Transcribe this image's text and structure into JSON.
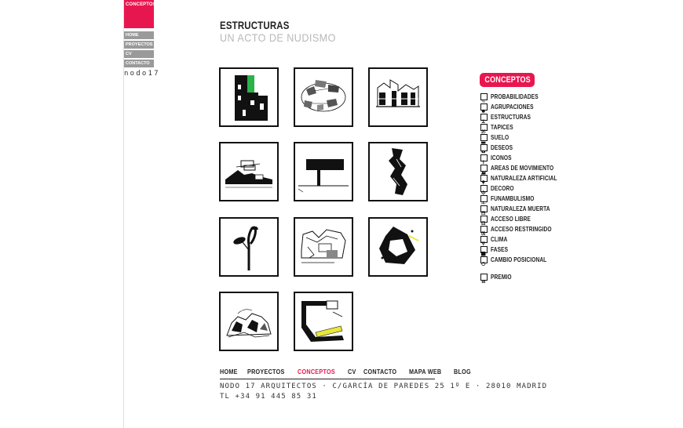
{
  "nav": {
    "logo_label": "CONCEPTOS",
    "items": [
      {
        "label": "HOME"
      },
      {
        "label": "PROYECTOS"
      },
      {
        "label": "CV"
      },
      {
        "label": "CONTACTO"
      }
    ],
    "brand": "nodo17"
  },
  "header": {
    "title": "ESTRUCTURAS",
    "subtitle": "UN ACTO DE NUDISMO"
  },
  "projects": {
    "count": 11
  },
  "sidebar": {
    "header": "CONCEPTOS",
    "items": [
      {
        "label": "PROBABILIDADES",
        "icon": "percent-icon"
      },
      {
        "label": "AGRUPACIONES",
        "icon": "circle-group-icon"
      },
      {
        "label": "ESTRUCTURAS",
        "icon": "structure-icon"
      },
      {
        "label": "TAPICES",
        "icon": "hatch-icon"
      },
      {
        "label": "SUELO",
        "icon": "ground-icon"
      },
      {
        "label": "DESEOS",
        "icon": "wish-icon"
      },
      {
        "label": "ICONOS",
        "icon": "info-icon"
      },
      {
        "label": "AREAS DE MOVIMIENTO",
        "icon": "movement-icon"
      },
      {
        "label": "NATURALEZA ARTIFICIAL",
        "icon": "tree-icon"
      },
      {
        "label": "DECORO",
        "icon": "decor-icon"
      },
      {
        "label": "FUNAMBULISMO",
        "icon": "tightrope-icon"
      },
      {
        "label": "NATURALEZA MUERTA",
        "icon": "still-life-icon"
      },
      {
        "label": "ACCESO LIBRE",
        "icon": "open-access-icon"
      },
      {
        "label": "ACCESO RESTRINGIDO",
        "icon": "restricted-access-icon"
      },
      {
        "label": "CLIMA",
        "icon": "climate-icon"
      },
      {
        "label": "FASES",
        "icon": "phases-icon"
      },
      {
        "label": "CAMBIO POSICIONAL",
        "icon": "position-change-icon"
      }
    ],
    "award": {
      "label": "PREMIO",
      "icon": "award-icon"
    }
  },
  "footer": {
    "links": [
      {
        "label": "HOME"
      },
      {
        "label": "PROYECTOS"
      },
      {
        "label": "CONCEPTOS",
        "active": true
      },
      {
        "label": "CV"
      },
      {
        "label": "CONTACTO"
      },
      {
        "label": "MAPA WEB"
      },
      {
        "label": "BLOG"
      }
    ],
    "address": "NODO 17 ARQUITECTOS · C/GARCÍA DE PAREDES 25 1º E · 28010 MADRID",
    "phone": "TL +34 91 445 85 31"
  },
  "colors": {
    "accent": "#e8164f",
    "nav_gray": "#9a9a9a",
    "highlight_green": "#2bb34a",
    "highlight_yellow": "#e8e83a"
  }
}
